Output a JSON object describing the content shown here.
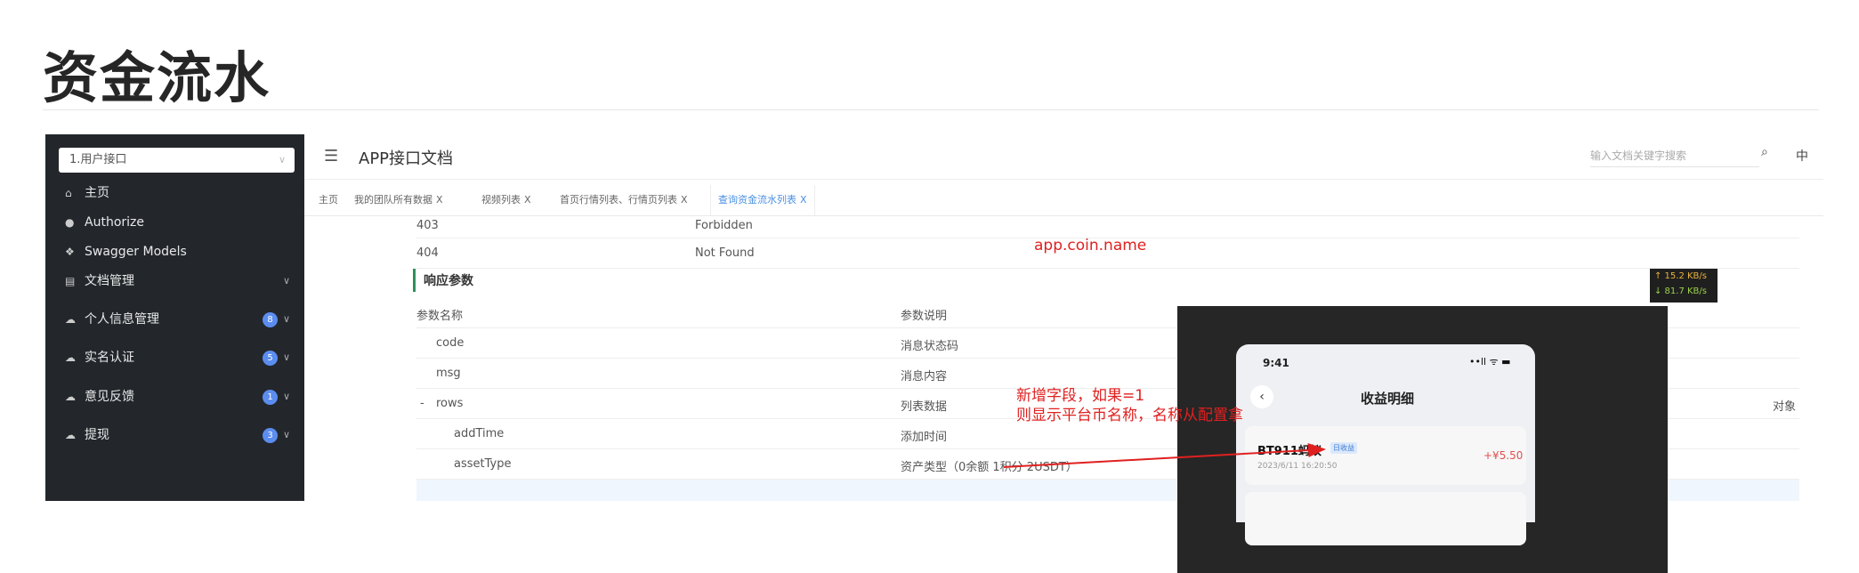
{
  "page": {
    "title": "资金流水"
  },
  "sidebar": {
    "group_select": "1.用户接口",
    "items": [
      {
        "label": "主页",
        "icon": "home-icon"
      },
      {
        "label": "Authorize",
        "icon": "lock-icon"
      },
      {
        "label": "Swagger Models",
        "icon": "box-icon"
      },
      {
        "label": "文档管理",
        "icon": "document-icon"
      },
      {
        "label": "个人信息管理",
        "icon": "cloud-icon",
        "badge": "8"
      },
      {
        "label": "实名认证",
        "icon": "cloud-icon",
        "badge": "5"
      },
      {
        "label": "意见反馈",
        "icon": "cloud-icon",
        "badge": "1"
      },
      {
        "label": "提现",
        "icon": "cloud-icon",
        "badge": "3"
      }
    ]
  },
  "header": {
    "title": "APP接口文档",
    "search_placeholder": "输入文档关键字搜索",
    "lang": "中"
  },
  "tabs": [
    {
      "label": "主页",
      "closable": false
    },
    {
      "label": "我的团队所有数据",
      "closable": true
    },
    {
      "label": "视频列表",
      "closable": true
    },
    {
      "label": "首页行情列表、行情页列表",
      "closable": true
    },
    {
      "label": "查询资金流水列表",
      "closable": true,
      "active": true
    }
  ],
  "tab_close": "X",
  "status_rows": [
    {
      "code": "403",
      "desc": "Forbidden"
    },
    {
      "code": "404",
      "desc": "Not Found"
    }
  ],
  "response": {
    "title": "响应参数",
    "col_name": "参数名称",
    "col_desc": "参数说明",
    "rows": [
      {
        "name": "code",
        "desc": "消息状态码"
      },
      {
        "name": "msg",
        "desc": "消息内容"
      },
      {
        "name": "rows",
        "desc": "列表数据",
        "expander": "-",
        "extra": "对象"
      },
      {
        "name": "addTime",
        "desc": "添加时间"
      },
      {
        "name": "assetType",
        "desc": "资产类型（0余额 1积分 2USDT）"
      }
    ]
  },
  "annotations": {
    "coin_name": "app.coin.name",
    "note_line1": "新增字段，如果=1",
    "note_line2": "则显示平台币名称，名称从配置拿"
  },
  "speed": {
    "up": "↑ 15.2 KB/s",
    "down": "↓ 81.7 KB/s"
  },
  "phone": {
    "time": "9:41",
    "status": "••ll ᯤ ▬",
    "back": "‹",
    "title": "收益明细",
    "card_name": "BT911蚂蚁",
    "card_tag": "日收益",
    "card_date": "2023/6/11 16:20:50",
    "card_amount": "+¥5.50"
  },
  "colors": {
    "sidebar_bg": "#23272c",
    "accent": "#4a90e2",
    "annotation": "#e02020",
    "badge": "#5b8def"
  }
}
